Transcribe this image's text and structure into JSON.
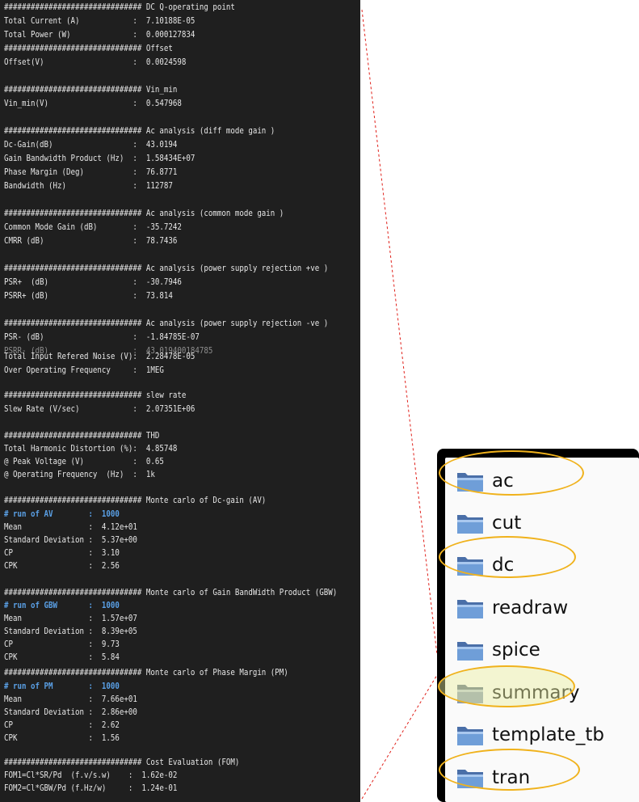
{
  "terminal": {
    "lines": [
      {
        "text": "############################### DC Q-operating point"
      },
      {
        "text": "Total Current (A)            :  7.10188E-05"
      },
      {
        "text": "Total Power (W)              :  0.000127834"
      },
      {
        "text": "############################### Offset"
      },
      {
        "text": "Offset(V)                    :  0.0024598"
      },
      {
        "text": "############################### Vin_min"
      },
      {
        "text": "Vin_min(V)                   :  0.547968"
      },
      {
        "text": "############################### Ac analysis (diff mode gain )"
      },
      {
        "text": "Dc-Gain(dB)                  :  43.0194"
      },
      {
        "text": "Gain Bandwidth Product (Hz)  :  1.58434E+07"
      },
      {
        "text": "Phase Margin (Deg)           :  76.8771"
      },
      {
        "text": "Bandwidth (Hz)               :  112787"
      },
      {
        "text": "############################### Ac analysis (common mode gain )"
      },
      {
        "text": "Common Mode Gain (dB)        :  -35.7242"
      },
      {
        "text": "CMRR (dB)                    :  78.7436"
      },
      {
        "text": "############################### Ac analysis (power supply rejection +ve )"
      },
      {
        "text": "PSR+  (dB)                   :  -30.7946"
      },
      {
        "text": "PSRR+ (dB)                   :  73.814"
      },
      {
        "text": "############################### Ac analysis (power supply rejection -ve )"
      },
      {
        "text": "PSR- (dB)                    :  -1.84785E-07"
      },
      {
        "text": "PSRR- (dB)                   :  43.019400184785"
      },
      {
        "text": "Total Input Refered Noise (V):  2.28478E-05"
      },
      {
        "text": "Over Operating Frequency     :  1MEG"
      },
      {
        "text": "############################### slew rate"
      },
      {
        "text": "Slew Rate (V/sec)            :  2.07351E+06"
      },
      {
        "text": "############################### THD"
      },
      {
        "text": "Total Harmonic Distortion (%):  4.85748"
      },
      {
        "text": "@ Peak Voltage (V)           :  0.65"
      },
      {
        "text": "@ Operating Frequency  (Hz)  :  1k"
      },
      {
        "text": "############################### Monte carlo of Dc-gain (AV)"
      },
      {
        "text": "# run of AV        :  1000"
      },
      {
        "text": "Mean               :  4.12e+01"
      },
      {
        "text": "Standard Deviation :  5.37e+00"
      },
      {
        "text": "CP                 :  3.10"
      },
      {
        "text": "CPK                :  2.56"
      },
      {
        "text": "############################### Monte carlo of Gain BandWidth Product (GBW)"
      },
      {
        "text": "# run of GBW       :  1000"
      },
      {
        "text": "Mean               :  1.57e+07"
      },
      {
        "text": "Standard Deviation :  8.39e+05"
      },
      {
        "text": "CP                 :  9.73"
      },
      {
        "text": "CPK                :  5.84"
      },
      {
        "text": "############################### Monte carlo of Phase Margin (PM)"
      },
      {
        "text": "# run of PM        :  1000"
      },
      {
        "text": "Mean               :  7.66e+01"
      },
      {
        "text": "Standard Deviation :  2.86e+00"
      },
      {
        "text": "CP                 :  2.62"
      },
      {
        "text": "CPK                :  1.56"
      },
      {
        "text": "############################### Cost Evaluation (FOM)"
      },
      {
        "text": "FOM1=Cl*SR/Pd  (f.v/s.w)    :  1.62e-02"
      },
      {
        "text": "FOM2=Cl*GBW/Pd (f.Hz/w)     :  1.24e-01"
      }
    ]
  },
  "folders": {
    "items": [
      {
        "label": "ac",
        "icon": "folder-icon"
      },
      {
        "label": "cut",
        "icon": "folder-icon"
      },
      {
        "label": "dc",
        "icon": "folder-icon"
      },
      {
        "label": "readraw",
        "icon": "folder-icon"
      },
      {
        "label": "spice",
        "icon": "folder-icon"
      },
      {
        "label": "summary",
        "icon": "folder-icon"
      },
      {
        "label": "template_tb",
        "icon": "folder-icon"
      },
      {
        "label": "tran",
        "icon": "folder-icon"
      }
    ],
    "highlighted": [
      "ac",
      "dc",
      "summary",
      "tran"
    ]
  },
  "colors": {
    "terminal_bg": "#1f1f1f",
    "terminal_text": "#e6e6e6",
    "terminal_highlight": "#5aa0e6",
    "ring": "#f0b21c",
    "connector": "#e0201a",
    "folder_front": "#6f9ed8",
    "folder_back": "#4a6fa8"
  }
}
